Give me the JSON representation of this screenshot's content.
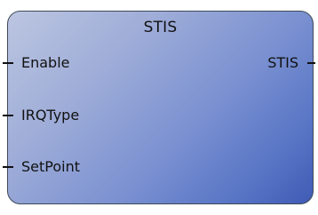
{
  "block": {
    "title": "STIS",
    "inputs": [
      "Enable",
      "IRQType",
      "SetPoint"
    ],
    "outputs": [
      "STIS"
    ]
  },
  "colors": {
    "border": "#3f4a58",
    "gradient_light": "#bcc6e1",
    "gradient_dark": "#3f5bb5",
    "text": "#111111"
  }
}
